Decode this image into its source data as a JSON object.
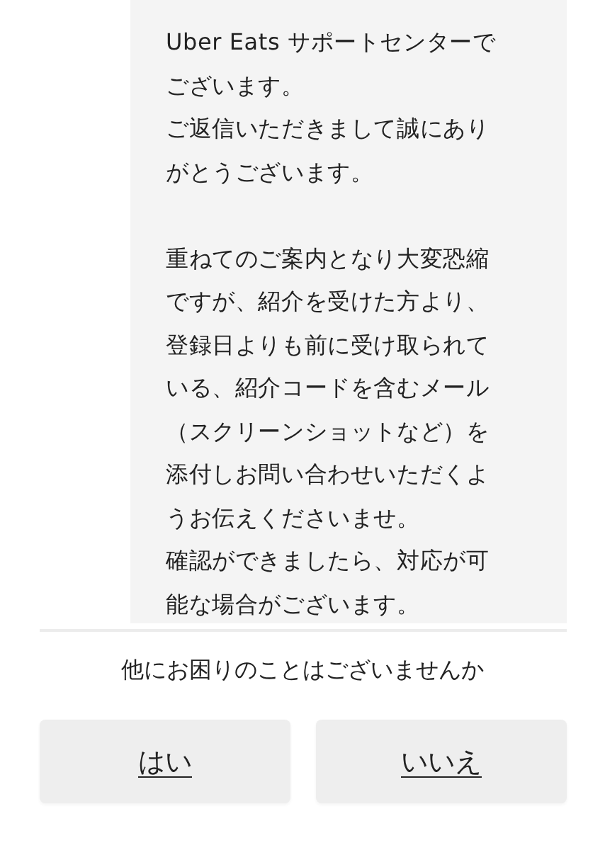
{
  "message": {
    "blocks": [
      [
        "Uber Eats サポートセンターでございます。",
        "ご返信いただきまして誠にありがとうございます。"
      ],
      [
        "重ねてのご案内となり大変恐縮ですが、紹介を受けた方より、登録日よりも前に受け取られている、紹介コードを含むメール（スクリーンショットなど）を添付しお問い合わせいただくようお伝えくださいませ。",
        "確認ができましたら、対応が可能な場合がございます。"
      ]
    ]
  },
  "question": "他にお困りのことはございませんか",
  "buttons": [
    {
      "label": "はい"
    },
    {
      "label": "いいえ"
    }
  ]
}
